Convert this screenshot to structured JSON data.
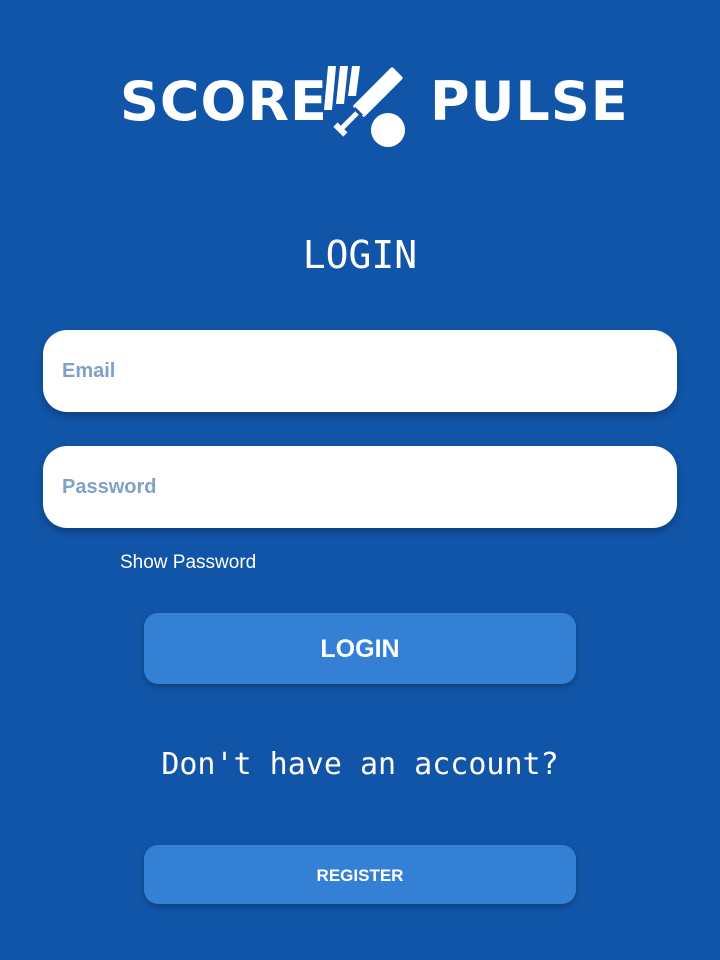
{
  "logo": {
    "left_word": "SCORE",
    "right_word": "PULSE",
    "icon": "cricket-bat-ball-icon"
  },
  "login_title": "LOGIN",
  "email": {
    "placeholder": "Email",
    "value": ""
  },
  "password": {
    "placeholder": "Password",
    "value": ""
  },
  "show_password_label": "Show Password",
  "login_button_label": "LOGIN",
  "no_account_text": "Don't have an account?",
  "register_button_label": "REGISTER",
  "colors": {
    "background": "#1155a8",
    "button": "#3480d4",
    "placeholder": "#7ea1c6",
    "text": "#ffffff"
  }
}
